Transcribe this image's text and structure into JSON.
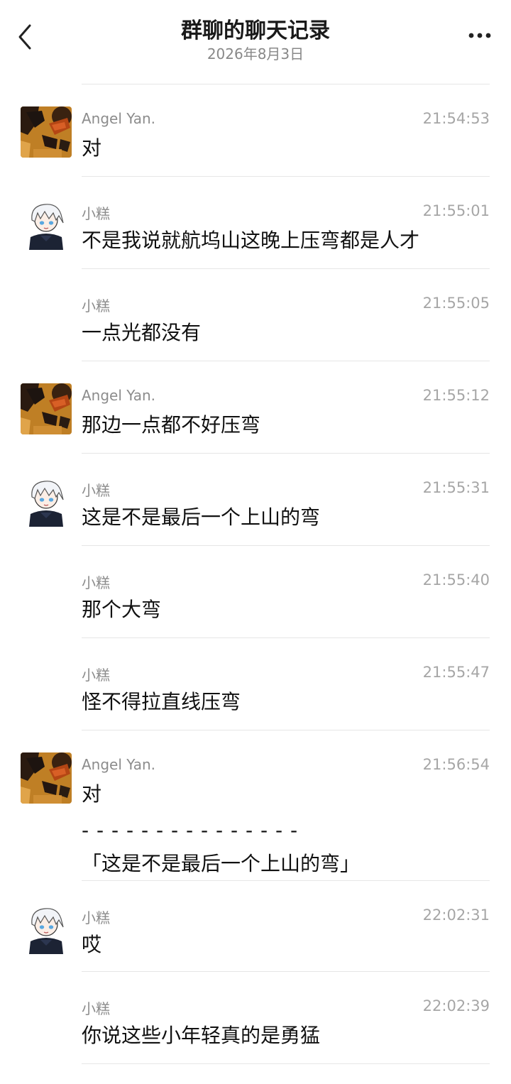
{
  "header": {
    "title": "群聊的聊天记录",
    "date": "2026年8月3日",
    "back_icon": "chevron-left-icon",
    "more_icon": "more-horizontal-icon"
  },
  "colors": {
    "text": "#111111",
    "sender": "#8c8c8c",
    "time": "#a6a6a6",
    "divider": "#e6e6e6"
  },
  "messages": [
    {
      "sender": "Angel Yan.",
      "time": "21:54:53",
      "text": "对",
      "avatar": "angel"
    },
    {
      "sender": "小糕",
      "time": "21:55:01",
      "text": "不是我说就航坞山这晚上压弯都是人才",
      "avatar": "xiaogao"
    },
    {
      "sender": "小糕",
      "time": "21:55:05",
      "text": "一点光都没有",
      "avatar": ""
    },
    {
      "sender": "Angel Yan.",
      "time": "21:55:12",
      "text": "那边一点都不好压弯",
      "avatar": "angel"
    },
    {
      "sender": "小糕",
      "time": "21:55:31",
      "text": "这是不是最后一个上山的弯",
      "avatar": "xiaogao"
    },
    {
      "sender": "小糕",
      "time": "21:55:40",
      "text": "那个大弯",
      "avatar": ""
    },
    {
      "sender": "小糕",
      "time": "21:55:47",
      "text": "怪不得拉直线压弯",
      "avatar": ""
    },
    {
      "sender": "Angel Yan.",
      "time": "21:56:54",
      "text": "对",
      "quote_separator": "- - - - - - - - - - - - - - -",
      "quote": "「这是不是最后一个上山的弯」",
      "avatar": "angel"
    },
    {
      "sender": "小糕",
      "time": "22:02:31",
      "text": "哎",
      "avatar": "xiaogao"
    },
    {
      "sender": "小糕",
      "time": "22:02:39",
      "text": "你说这些小年轻真的是勇猛",
      "avatar": ""
    }
  ]
}
